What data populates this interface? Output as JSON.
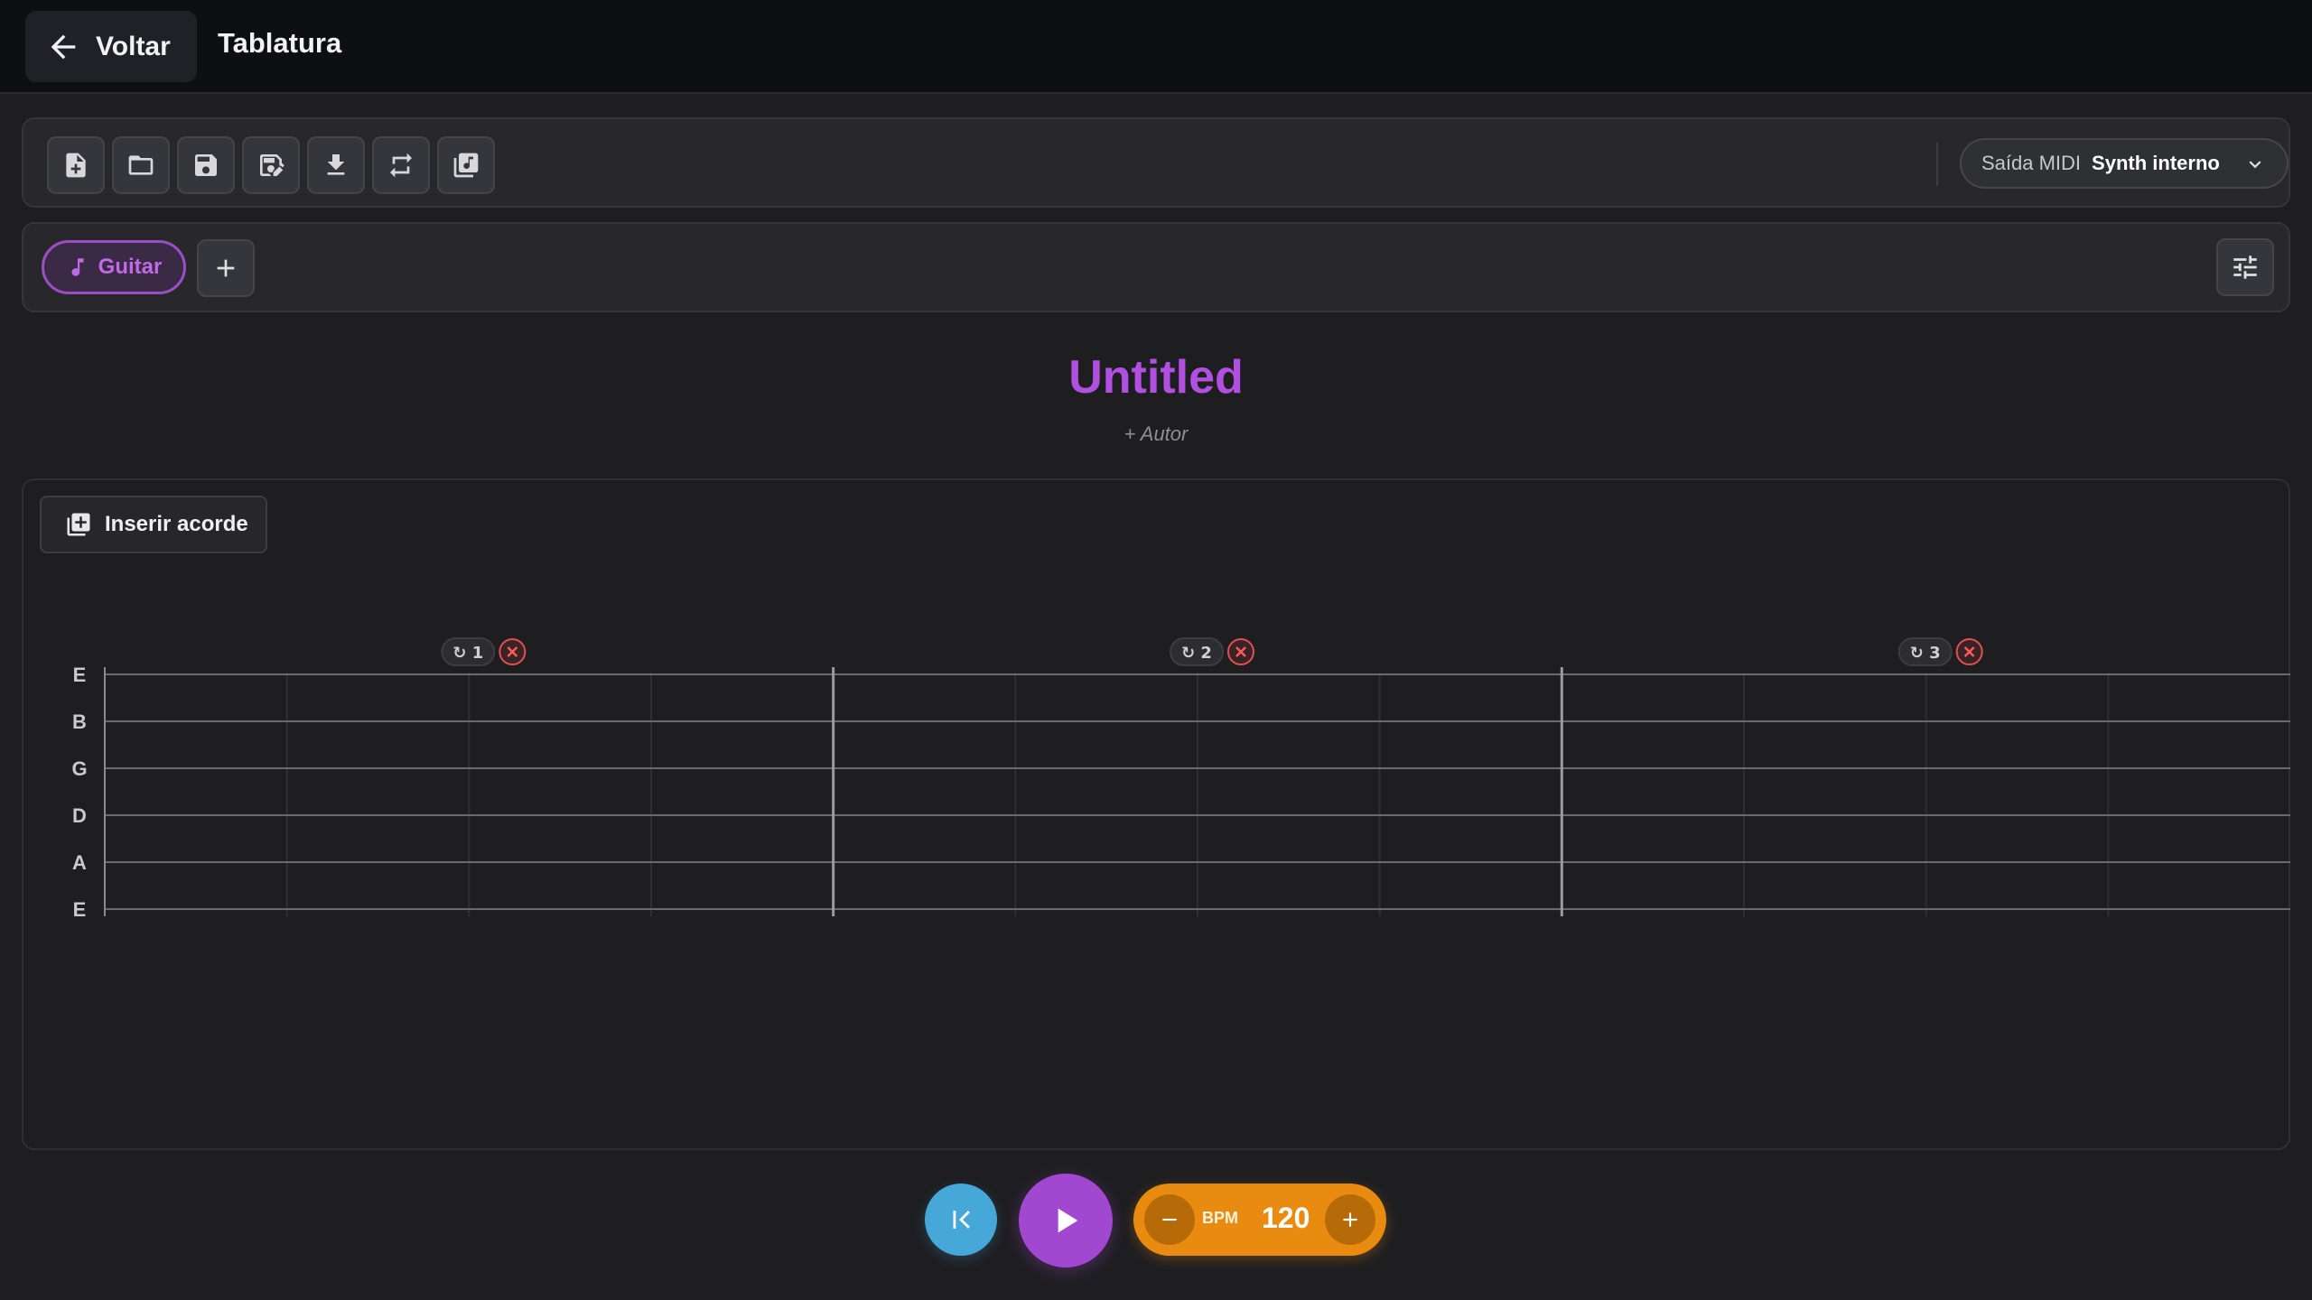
{
  "header": {
    "back_label": "Voltar",
    "title": "Tablatura"
  },
  "toolbar": {
    "buttons": [
      {
        "name": "new-file-button",
        "icon": "file-plus-icon"
      },
      {
        "name": "open-folder-button",
        "icon": "folder-icon"
      },
      {
        "name": "save-button",
        "icon": "save-icon"
      },
      {
        "name": "save-as-button",
        "icon": "save-edit-icon"
      },
      {
        "name": "download-button",
        "icon": "download-icon"
      },
      {
        "name": "repeat-button",
        "icon": "repeat-icon"
      },
      {
        "name": "chord-library-button",
        "icon": "music-library-icon"
      }
    ],
    "midi_label": "Saída MIDI",
    "midi_value": "Synth interno"
  },
  "tracks": {
    "items": [
      {
        "label": "Guitar",
        "icon": "music-note-icon",
        "active": true
      }
    ],
    "accent": "#b150e0"
  },
  "song": {
    "title": "Untitled",
    "author_placeholder": "+ Autor"
  },
  "editor": {
    "insert_chord_label": "Inserir acorde",
    "strings": [
      "E",
      "B",
      "G",
      "D",
      "A",
      "E"
    ],
    "measures": [
      {
        "repeat_label": "↻ 1"
      },
      {
        "repeat_label": "↻ 2"
      },
      {
        "repeat_label": "↻ 3"
      }
    ],
    "beats_per_measure": 4
  },
  "transport": {
    "bpm_label": "BPM",
    "bpm_value": "120",
    "colors": {
      "rewind": "#46a8d8",
      "play": "#a247cf",
      "bpm": "#e98b10"
    }
  }
}
